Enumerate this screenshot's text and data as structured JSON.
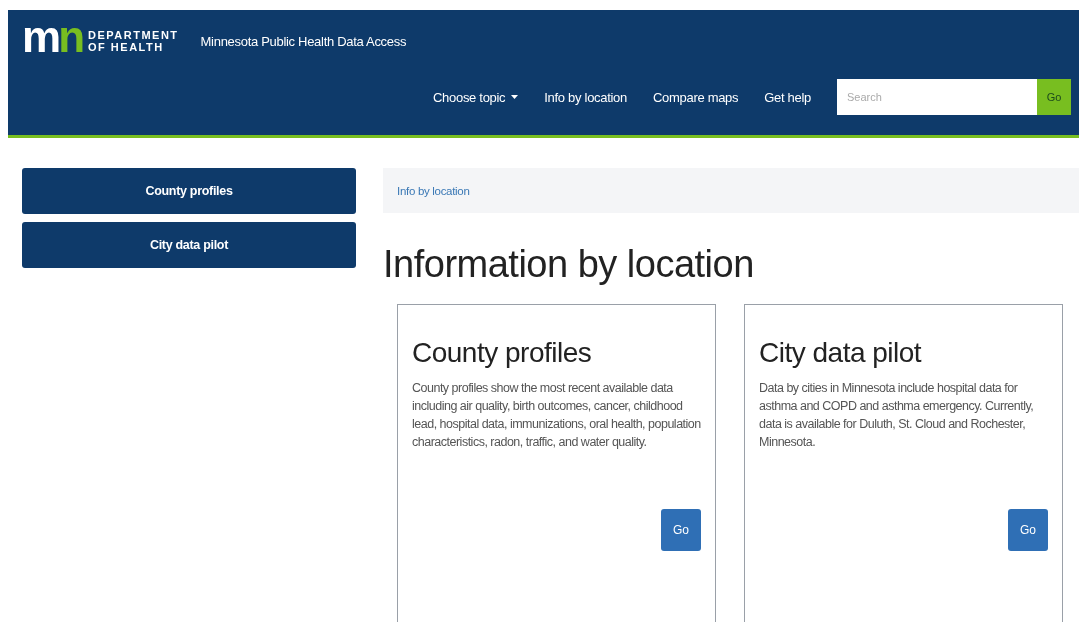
{
  "header": {
    "logo": {
      "mark": [
        "m",
        "n"
      ],
      "lines": [
        "DEPARTMENT",
        "OF HEALTH"
      ]
    },
    "site_title": "Minnesota Public Health Data Access",
    "nav": [
      {
        "label": "Choose topic",
        "dropdown": true
      },
      {
        "label": "Info by location",
        "dropdown": false
      },
      {
        "label": "Compare maps",
        "dropdown": false
      },
      {
        "label": "Get help",
        "dropdown": false
      }
    ],
    "search": {
      "placeholder": "Search",
      "button": "Go"
    }
  },
  "sidebar": {
    "items": [
      "County profiles",
      "City data pilot"
    ]
  },
  "breadcrumb": "Info by location",
  "page_title": "Information by location",
  "cards": [
    {
      "title": "County profiles",
      "text": "County profiles show the most recent available data including air quality, birth outcomes, cancer, childhood lead, hospital data, immunizations, oral health, population characteristics, radon, traffic, and water quality.",
      "button": "Go"
    },
    {
      "title": "City data pilot",
      "text": "Data by cities in Minnesota include hospital data for asthma and COPD and asthma emergency. Currently, data is available for Duluth, St. Cloud and Rochester, Minnesota.",
      "button": "Go"
    }
  ]
}
